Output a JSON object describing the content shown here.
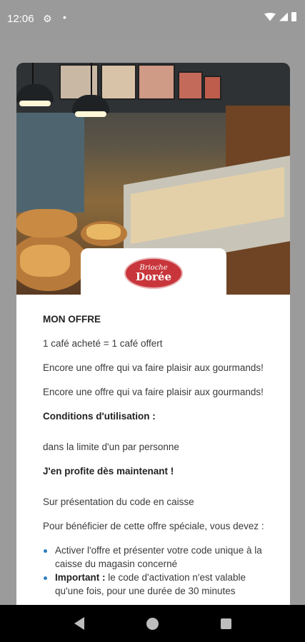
{
  "status_bar": {
    "time": "12:06",
    "icons": [
      "gear-icon",
      "dot-icon",
      "wifi-icon",
      "signal-icon",
      "battery-icon"
    ]
  },
  "brand": {
    "logo_line1": "Brioche",
    "logo_line2": "Dorée",
    "logo_color": "#c8363b"
  },
  "offer": {
    "heading": "MON OFFRE",
    "summary": "1 café acheté = 1 café offert",
    "paragraph1": "Encore une offre qui va faire plaisir aux gourmands!",
    "paragraph2": "Encore une offre qui va faire plaisir aux gourmands!",
    "conditions_title": "Conditions d'utilisation :",
    "conditions_text": "dans la limite d'un par personne",
    "cta_title": "J'en profite dès maintenant !",
    "presentation_text": "Sur présentation du code en caisse",
    "intro_text": "Pour bénéficier de cette offre spéciale, vous devez :",
    "bullets": [
      {
        "strong": "",
        "text": "Activer l'offre et présenter votre code unique à la caisse du magasin concerné"
      },
      {
        "strong": "Important :",
        "text": " le code d'activation n'est valable qu'une fois, pour une durée de 30 minutes"
      }
    ]
  },
  "nav": {
    "icons": [
      "back-icon",
      "home-icon",
      "recent-apps-icon"
    ]
  }
}
